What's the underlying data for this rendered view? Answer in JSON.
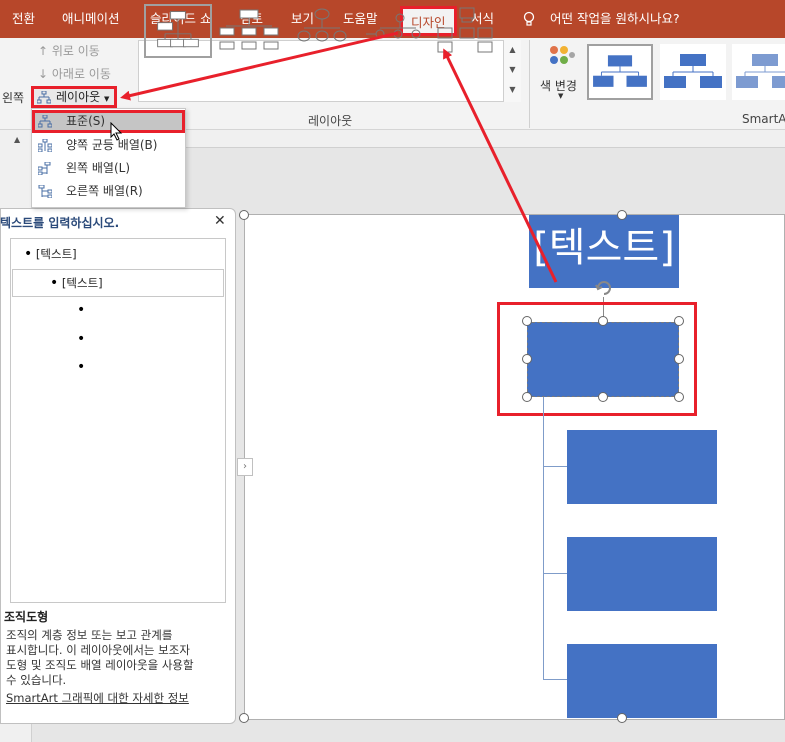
{
  "tabs": {
    "transitions": "전환",
    "animations": "애니메이션",
    "slideshow": "슬라이드 쇼",
    "review": "검토",
    "view": "보기",
    "help": "도움말",
    "design": "디자인",
    "format": "서식",
    "tellme": "어떤 작업을 원하시나요?"
  },
  "ribbon": {
    "move_up": "위로 이동",
    "move_down": "아래로 이동",
    "right_to_left_partial": "왼쪽",
    "layout_button": "레이아웃",
    "layouts_group": "레이아웃",
    "change_colors": "색 변경",
    "smartart_styles_partial": "SmartArt"
  },
  "layout_menu": {
    "items": [
      {
        "label": "표준(S)"
      },
      {
        "label": "양쪽 균등 배열(B)"
      },
      {
        "label": "왼쪽 배열(L)"
      },
      {
        "label": "오른쪽 배열(R)"
      }
    ]
  },
  "text_pane": {
    "title": "텍스트를 입력하십시오.",
    "item1": "[텍스트]",
    "item2": "[텍스트]",
    "desc_title": "조직도형",
    "desc_lines": [
      "조직의 계층 정보 또는 보고 관계를",
      "표시합니다. 이 레이아웃에서는 보조자",
      "도형 및 조직도 배열 레이아웃을 사용할",
      "수 있습니다."
    ],
    "more_info": "SmartArt 그래픽에 대한 자세한 정보"
  },
  "slide": {
    "title_text": "[텍스트]"
  },
  "colors": {
    "accent": "#b7472a",
    "highlight": "#e8202b",
    "shape": "#4472c4"
  }
}
